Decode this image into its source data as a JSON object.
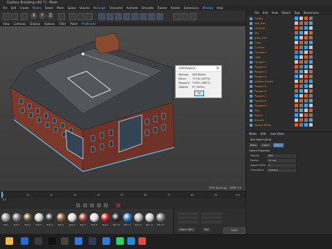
{
  "window": {
    "title": "Gallery Building.c4d *) - Main"
  },
  "menus": [
    "File",
    "Edit",
    "Create",
    "Modes",
    "Select",
    "Mesh",
    "Spline",
    "Volume",
    "MoGraph",
    "Character",
    "Animate",
    "Simulate",
    "Tracker",
    "Render",
    "Extensions",
    "Window",
    "Help"
  ],
  "menu_hl": [
    "Modes",
    "Mograph",
    "Window"
  ],
  "toolbar": {
    "axes": [
      "X",
      "Y",
      "Z"
    ]
  },
  "view_menu": [
    "View",
    "Cameras",
    "Display",
    "Options",
    "Filter",
    "Panel",
    "ProRender"
  ],
  "info_dialog": {
    "title": "Information",
    "close": "×",
    "rows": [
      {
        "label": "Memory:",
        "value": "598 KB/sec"
      },
      {
        "label": "Points:",
        "value": "77172 (30971)"
      },
      {
        "label": "Polygons:",
        "value": "73951 (28871)"
      },
      {
        "label": "Objects:",
        "value": "97 (100%)"
      }
    ],
    "ok": "OK"
  },
  "viewport": {
    "grid_spacing": "Grid Spacing : 1000 cm"
  },
  "timeline": {
    "ticks": [
      "0",
      "10",
      "20",
      "30",
      "40",
      "50",
      "60",
      "70",
      "80",
      "90",
      "100"
    ],
    "frame": "0 F"
  },
  "materials": {
    "items": [
      {
        "label": "Mat",
        "color": "#9a9a9a"
      },
      {
        "label": "Mat.1",
        "color": "#707070"
      },
      {
        "label": "Mat.2",
        "color": "#6b5336"
      },
      {
        "label": "Mat.3",
        "color": "#c7c7c7"
      },
      {
        "label": "Mat.4",
        "color": "#3a3a3a"
      },
      {
        "label": "Mat.5",
        "color": "#8a5a2b"
      },
      {
        "label": "Mat.6",
        "color": "#d8d8d8"
      },
      {
        "label": "Mat.7",
        "color": "#9c4030"
      },
      {
        "label": "Mat.8",
        "color": "#e0e0e0"
      },
      {
        "label": "Mat.9",
        "color": "#d02020"
      },
      {
        "label": "Mat.10",
        "color": "#2a2a2a"
      },
      {
        "label": "Mat.11",
        "color": "#2b7fd0"
      },
      {
        "label": "Mat.12",
        "color": "#b0b0b0"
      },
      {
        "label": "Mat.13",
        "color": "#c9c9c9"
      },
      {
        "label": "Mat.14",
        "color": "#7d7d7d"
      }
    ]
  },
  "coords": {
    "apply": "Apply",
    "mode": "Object (Rel)",
    "size": "Size"
  },
  "object_manager": {
    "menu": [
      "File",
      "Edit",
      "View",
      "Object",
      "Tags",
      "Bookmarks"
    ],
    "rows": [
      "Gallery",
      "roof_tiles",
      "chimney",
      "Sky",
      "glass_roof",
      "Cube",
      "Cylinder",
      "Cylinder.1",
      "Light",
      "Polygon.1",
      "Polygon.2",
      "Polygon.3",
      "Polygon.4",
      "window_frames",
      "Polygon.5",
      "Polygon.6",
      "Polygon.7",
      "Polygon.8",
      "Polygon.9",
      "Null",
      "Spline",
      "Extrude",
      "facade_bricks"
    ]
  },
  "attributes": {
    "tabs": [
      "Mode",
      "Edit",
      "User Data"
    ],
    "object": "Null Object [Null]",
    "subtabs": [
      "Basic",
      "Coord.",
      "Object"
    ],
    "section": "Object Properties",
    "props": [
      {
        "label": "Display",
        "value": "Dot"
      },
      {
        "label": "Radius",
        "value": "10 cm"
      },
      {
        "label": "Aspect Ratio",
        "value": "1"
      },
      {
        "label": "Orientation",
        "value": "Camera"
      }
    ]
  },
  "colors": {
    "accent": "#5fb0ff",
    "object_name": "#e08a3a"
  }
}
